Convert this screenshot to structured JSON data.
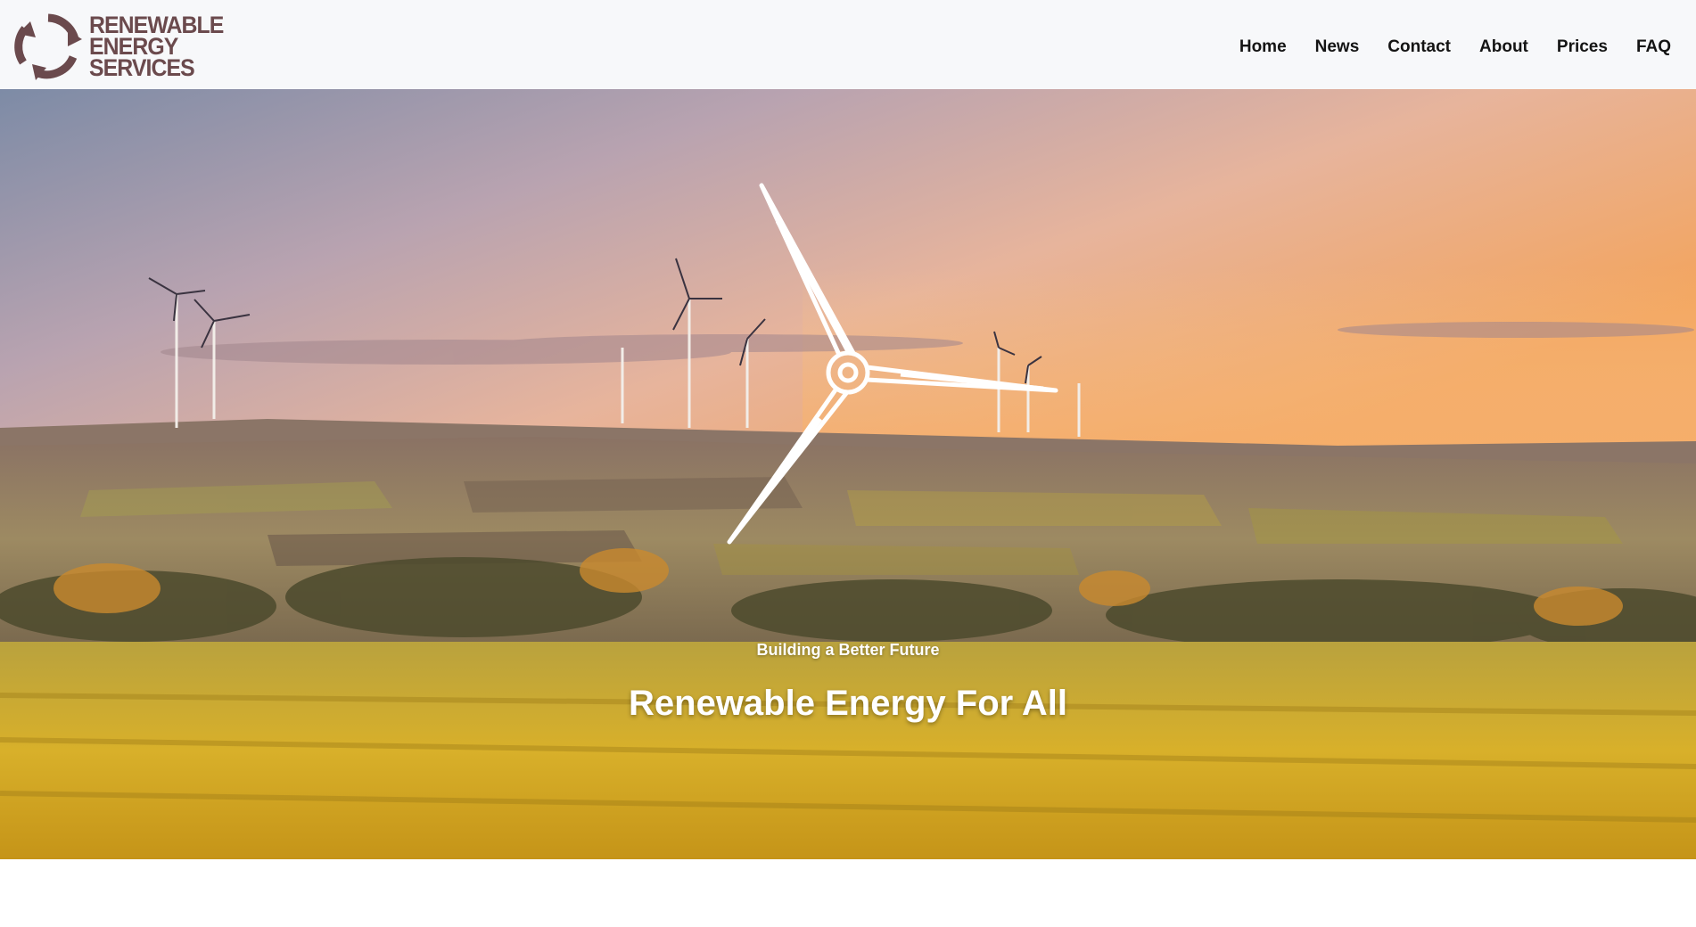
{
  "brand": {
    "logo_icon": "recycle-arrows-icon",
    "logo_lines": [
      "RENEWABLE",
      "ENERGY",
      "SERVICES"
    ],
    "color": "#6b4a4d"
  },
  "nav": {
    "items": [
      {
        "label": "Home"
      },
      {
        "label": "News"
      },
      {
        "label": "Contact"
      },
      {
        "label": "About"
      },
      {
        "label": "Prices"
      },
      {
        "label": "FAQ"
      }
    ]
  },
  "hero": {
    "icon": "wind-turbine-icon",
    "subtitle": "Building a Better Future",
    "title": "Renewable Energy For All"
  }
}
